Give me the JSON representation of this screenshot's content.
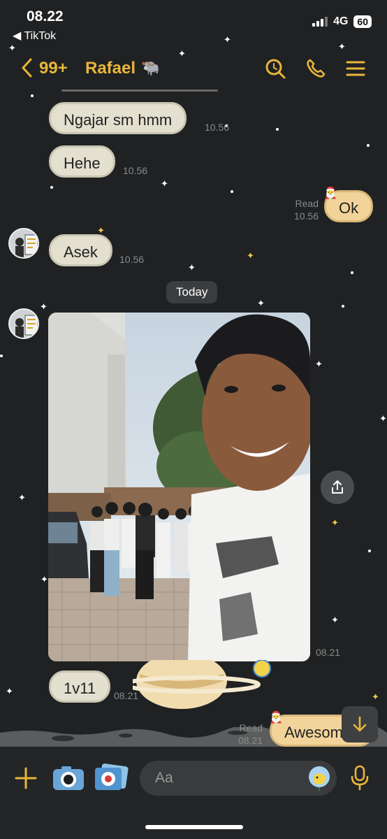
{
  "status_bar": {
    "time": "08.22",
    "back_app": "◀ TikTok",
    "network": "4G",
    "battery": "60"
  },
  "header": {
    "unread_count": "99+",
    "contact_name": "Rafael",
    "contact_emoji": "🐃"
  },
  "messages": [
    {
      "text": "Ngajar sm hmm",
      "time": "10.56",
      "sender": "contact"
    },
    {
      "text": "Hehe",
      "time": "10.56",
      "sender": "contact"
    },
    {
      "text": "Ok",
      "time": "10.56",
      "status": "Read",
      "sender": "me"
    },
    {
      "text": "Asek",
      "time": "10.56",
      "sender": "contact"
    },
    {
      "date_divider": "Today"
    },
    {
      "type": "photo",
      "time": "08.21",
      "sender": "contact"
    },
    {
      "text": "1v11",
      "time": "08.21",
      "sender": "contact"
    },
    {
      "text": "Awesom",
      "time": "08.21",
      "status": "Read",
      "sender": "me"
    }
  ],
  "composer": {
    "placeholder": "Aa"
  },
  "colors": {
    "accent": "#e8b63a",
    "background": "#1f2123",
    "incoming_bubble": "#e3e0cf",
    "outgoing_bubble": "#f2d49a"
  }
}
